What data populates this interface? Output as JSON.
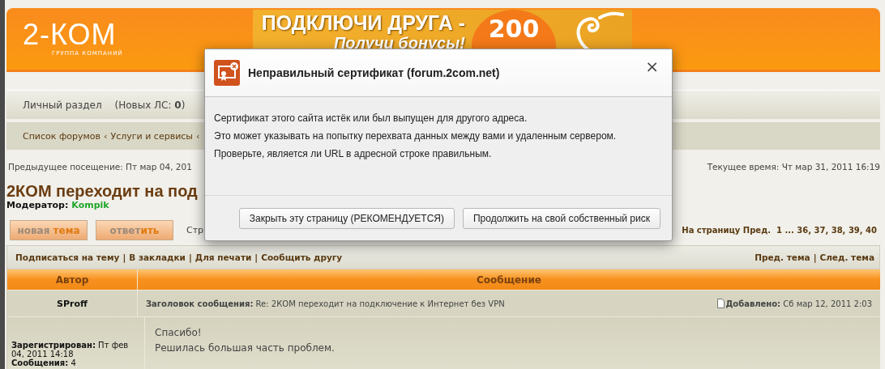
{
  "header": {
    "logo": {
      "name": "2-КОМ",
      "tagline": "ГРУППА КОМПАНИЙ"
    },
    "banner": {
      "headline": "ПОДКЛЮЧИ ДРУГА -",
      "subline": "Получи бонусы!",
      "badge": "200"
    }
  },
  "nav": [
    "Личный раздел",
    "(Новых ЛС: **0**)"
  ],
  "breadcrumb": {
    "items": [
      "Список форумов",
      "Услуги и сервисы"
    ],
    "separator": "‹"
  },
  "info": {
    "last_visit": "Предыдущее посещение: Пт мар 04, 201",
    "current_time": "Текущее время: Чт мар 31, 2011 16:19"
  },
  "topic": {
    "title": "2КОМ переходит на под",
    "moderator_label": "Модератор:",
    "moderator": "Kompik"
  },
  "buttons": [
    {
      "muted": "новая ",
      "accent": "тема"
    },
    {
      "muted": "ответ",
      "accent": "ить"
    }
  ],
  "pages_hint": "Стр",
  "pagination": "На страницу Пред.  1 ... 36, 37, 38, 39, 40",
  "topic_actions": {
    "items": [
      "Подписаться на тему",
      "В закладки",
      "Для печати",
      "Сообщить другу"
    ],
    "nav": [
      "Пред. тема",
      "След. тема"
    ],
    "separator": "|"
  },
  "table": {
    "columns": [
      "Автор",
      "Сообщение"
    ],
    "post": {
      "author": "SProff",
      "subject": "**Заголовок сообщения:** Re: 2КОМ переходит на подключение к Интернет без VPN",
      "posted": "**Добавлено:** Сб мар 12, 2011 2:03",
      "profile": [
        "**Зарегистрирован:** Пт фев 04, 2011 14:18",
        "**Сообщения:** 4"
      ],
      "body": [
        "Спасибо!",
        "Решилась большая часть проблем."
      ]
    }
  },
  "dialog": {
    "title": "Неправильный сертификат (forum.2com.net)",
    "close": "×",
    "lines": [
      "Сертификат этого сайта истёк или был выпущен для другого адреса.",
      "Это может указывать на попытку перехвата данных между вами и удаленным сервером.",
      "Проверьте, является ли URL в адресной строке правильным."
    ],
    "buttons": [
      "Закрыть эту страницу (РЕКОМЕНДУЕТСЯ)",
      "Продолжить на свой собственный риск"
    ]
  }
}
